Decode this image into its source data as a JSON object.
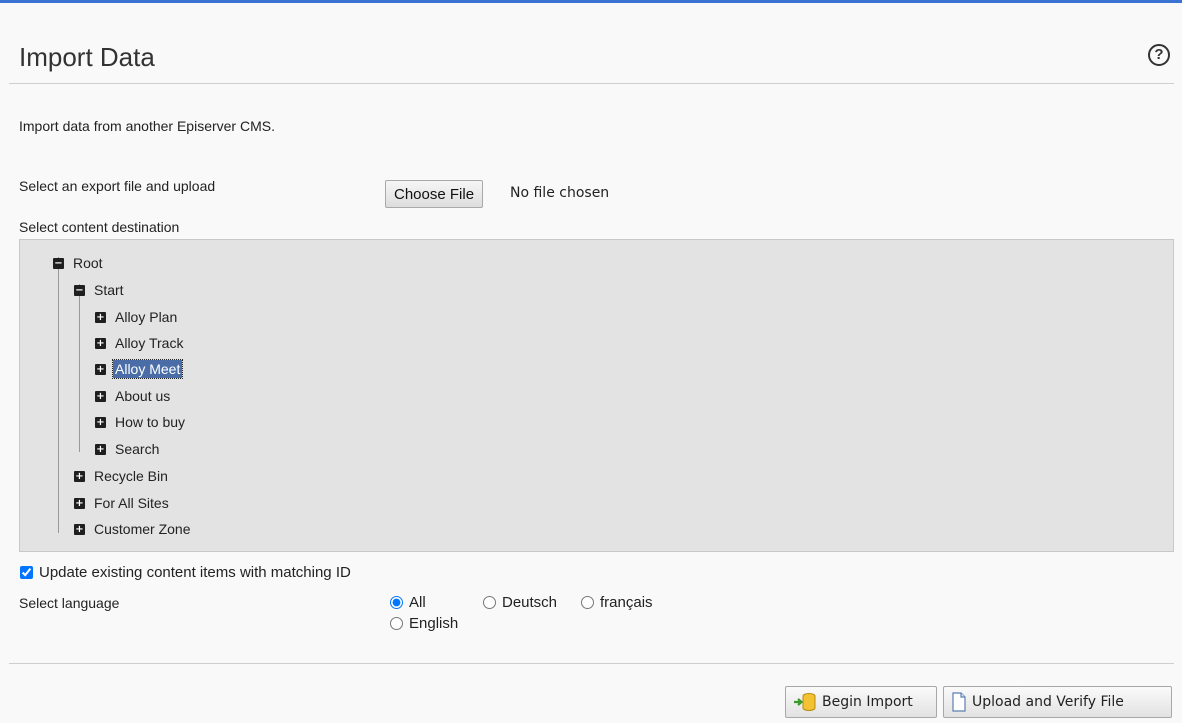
{
  "page": {
    "title": "Import Data",
    "help_glyph": "?",
    "intro": "Import data from another Episerver CMS."
  },
  "upload": {
    "label": "Select an export file and upload",
    "button_label": "Choose File",
    "status": "No file chosen"
  },
  "destination": {
    "label": "Select content destination",
    "tree": {
      "root": {
        "label": "Root",
        "state": "expanded"
      },
      "start": {
        "label": "Start",
        "state": "expanded"
      },
      "start_children": [
        {
          "label": "Alloy Plan",
          "state": "collapsed"
        },
        {
          "label": "Alloy Track",
          "state": "collapsed"
        },
        {
          "label": "Alloy Meet",
          "state": "collapsed",
          "selected": true
        },
        {
          "label": "About us",
          "state": "collapsed"
        },
        {
          "label": "How to buy",
          "state": "collapsed"
        },
        {
          "label": "Search",
          "state": "collapsed"
        }
      ],
      "root_children": [
        {
          "label": "Recycle Bin",
          "state": "collapsed"
        },
        {
          "label": "For All Sites",
          "state": "collapsed"
        },
        {
          "label": "Customer Zone",
          "state": "collapsed"
        }
      ],
      "expanded_glyph": "−",
      "collapsed_glyph": "+"
    }
  },
  "options": {
    "update_existing_label": "Update existing content items with matching ID",
    "update_existing_checked": true,
    "language_label": "Select language",
    "languages": [
      {
        "label": "All",
        "selected": true
      },
      {
        "label": "Deutsch",
        "selected": false
      },
      {
        "label": "français",
        "selected": false
      },
      {
        "label": "English",
        "selected": false
      }
    ]
  },
  "actions": {
    "begin_import_label": "Begin Import",
    "upload_verify_label": "Upload and Verify File"
  },
  "colors": {
    "accent": "#3b73d4",
    "tree_background": "#e3e3e3",
    "selection": "#4a6da7"
  },
  "icons": {
    "help": "help-icon",
    "expand": "expand-icon",
    "collapse": "collapse-icon",
    "import": "database-import-icon",
    "verify": "document-icon"
  }
}
